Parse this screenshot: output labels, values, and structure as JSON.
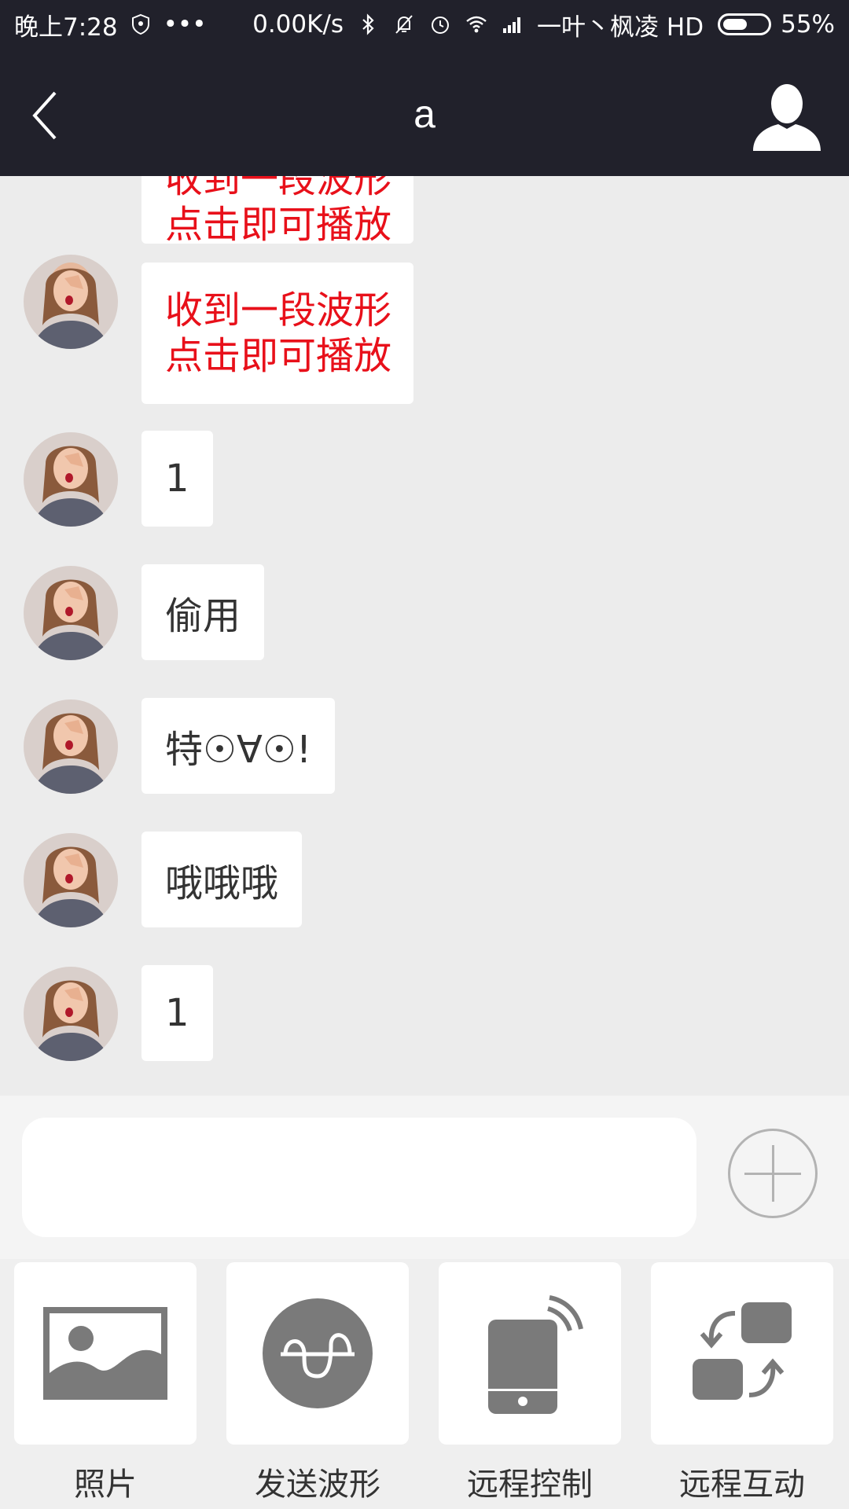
{
  "status_bar": {
    "time": "晚上7:28",
    "more": "•••",
    "net_speed": "0.00K/s",
    "carrier": "一叶丶枫凌 HD",
    "battery_percent": "55%",
    "battery_level": 0.55
  },
  "nav": {
    "title": "a"
  },
  "messages": [
    {
      "type": "wave",
      "line1": "收到一段波形",
      "line2": "点击即可播放"
    },
    {
      "type": "wave",
      "line1": "收到一段波形",
      "line2": "点击即可播放"
    },
    {
      "type": "text",
      "text": "1"
    },
    {
      "type": "text",
      "text": "偷用"
    },
    {
      "type": "text",
      "text": "特☉∀☉!"
    },
    {
      "type": "text",
      "text": "哦哦哦"
    },
    {
      "type": "text",
      "text": "1"
    }
  ],
  "input": {
    "placeholder": ""
  },
  "tools": [
    {
      "label": "照片",
      "icon": "image-icon"
    },
    {
      "label": "发送波形",
      "icon": "wave-icon"
    },
    {
      "label": "远程控制",
      "icon": "remote-phone-icon"
    },
    {
      "label": "远程互动",
      "icon": "interact-icon"
    }
  ],
  "colors": {
    "header_bg": "#21212b",
    "chat_bg": "#ececec",
    "wave_text": "#e8101a",
    "icon_gray": "#7a7a7a"
  }
}
